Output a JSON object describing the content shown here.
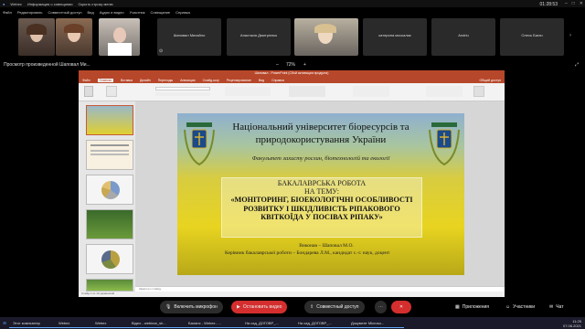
{
  "app": {
    "name": "Webex",
    "meeting_info_label": "Информация о совещании",
    "hide_menu_label": "Скрыть строку меню",
    "menu": [
      "Файл",
      "Редактировать",
      "Совместный доступ",
      "Вид",
      "Аудио и видео",
      "Участник",
      "Совещание",
      "Справка"
    ],
    "clock": "01:28:53"
  },
  "participants": [
    {
      "name": ""
    },
    {
      "name": ""
    },
    {
      "name": ""
    },
    {
      "name": "Шаповал Михайло"
    },
    {
      "name": "Анастасія Дмитрієнко"
    },
    {
      "name": ""
    },
    {
      "name": "катерина москалик"
    },
    {
      "name": "Andriu"
    },
    {
      "name": "Олесь Багач"
    }
  ],
  "share": {
    "viewing_label": "Просмотр произведенной Шаповал Ми...",
    "zoom": "72%"
  },
  "ppt": {
    "title_bar": "Шаповал - PowerPoint (Сбой активации продукта)",
    "tabs": [
      "Файл",
      "Главная",
      "Вставка",
      "Дизайн",
      "Переходы",
      "Анимация",
      "Слайд-шоу",
      "Рецензирование",
      "Вид",
      "Справка"
    ],
    "share_label": "Общий доступ",
    "notes_placeholder": "Заметки к слайду",
    "status_left": "Слайд 1 из 13   украинский",
    "thumb_count": 6
  },
  "slide": {
    "title": "Національний університет біоресурсів та природокористування України",
    "faculty": "Факультет захисту рослин, біотехнологій та екології",
    "kind": "БАКАЛАВРСЬКА РОБОТА",
    "theme_label": "НА ТЕМУ:",
    "topic": "«МОНІТОРИНГ, БІОЕКОЛОГІЧНІ ОСОБЛИВОСТІ РОЗВИТКУ І ШКІДЛИВІСТЬ РІПАКОВОГО КВІТКОЇДА У ПОСІВАХ РІПАКУ»",
    "executor": "Виконав – Шаповал М.О.",
    "supervisor": "Керівник бакалаврської роботи – Бондарева Л.М., кандидат с.-г. наук, доцент"
  },
  "controls": {
    "mic": "Включить микрофон",
    "video": "Остановить видео",
    "share": "Совместный доступ",
    "apps": "Приложения",
    "participants": "Участники",
    "chat": "Чат"
  },
  "taskbar": {
    "items": [
      "Этот компьютер",
      "Webex",
      "Webex",
      "Відео - webinar_sh...",
      "Баланс - Webex - ...",
      "На сад_ДОГОВР_...",
      "На сад_ДОГОВР_...",
      "Документ Microso..."
    ],
    "time": "11:25",
    "date": "07.06.2021"
  },
  "colors": {
    "ppt_accent": "#b7472a",
    "stop_video": "#d42e2e"
  }
}
